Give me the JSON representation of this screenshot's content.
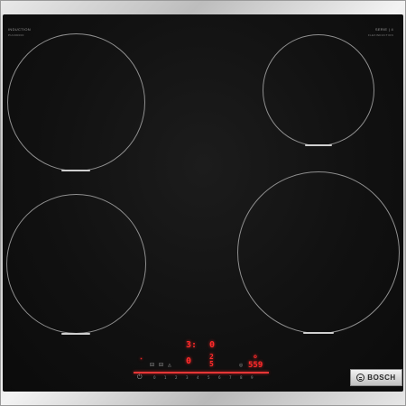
{
  "branding": {
    "left_label": "INDUCTION",
    "left_sub": "PIA000000",
    "right_label": "SERIE | 4",
    "right_sub": "FLEXINDUCTION",
    "logo_text": "BOSCH"
  },
  "zones": [
    {
      "name": "front-left-zone"
    },
    {
      "name": "rear-left-zone"
    },
    {
      "name": "rear-right-zone"
    },
    {
      "name": "front-right-zone"
    }
  ],
  "control_panel": {
    "upper_left_display": "3:",
    "upper_right_display": "0",
    "lower_left_display": "0",
    "lower_mid_display": "2",
    "lower_mid_second": "5",
    "timer_display": "559",
    "slider_numbers": [
      "0",
      "1",
      "2",
      "3",
      "4",
      "5",
      "6",
      "7",
      "8",
      "9"
    ],
    "accent_color": "#ff2a2a"
  },
  "icons": {
    "power": "power-icon",
    "timer": "timer-icon",
    "zone_select": "zone-select-icon",
    "child_lock": "lock-icon"
  }
}
